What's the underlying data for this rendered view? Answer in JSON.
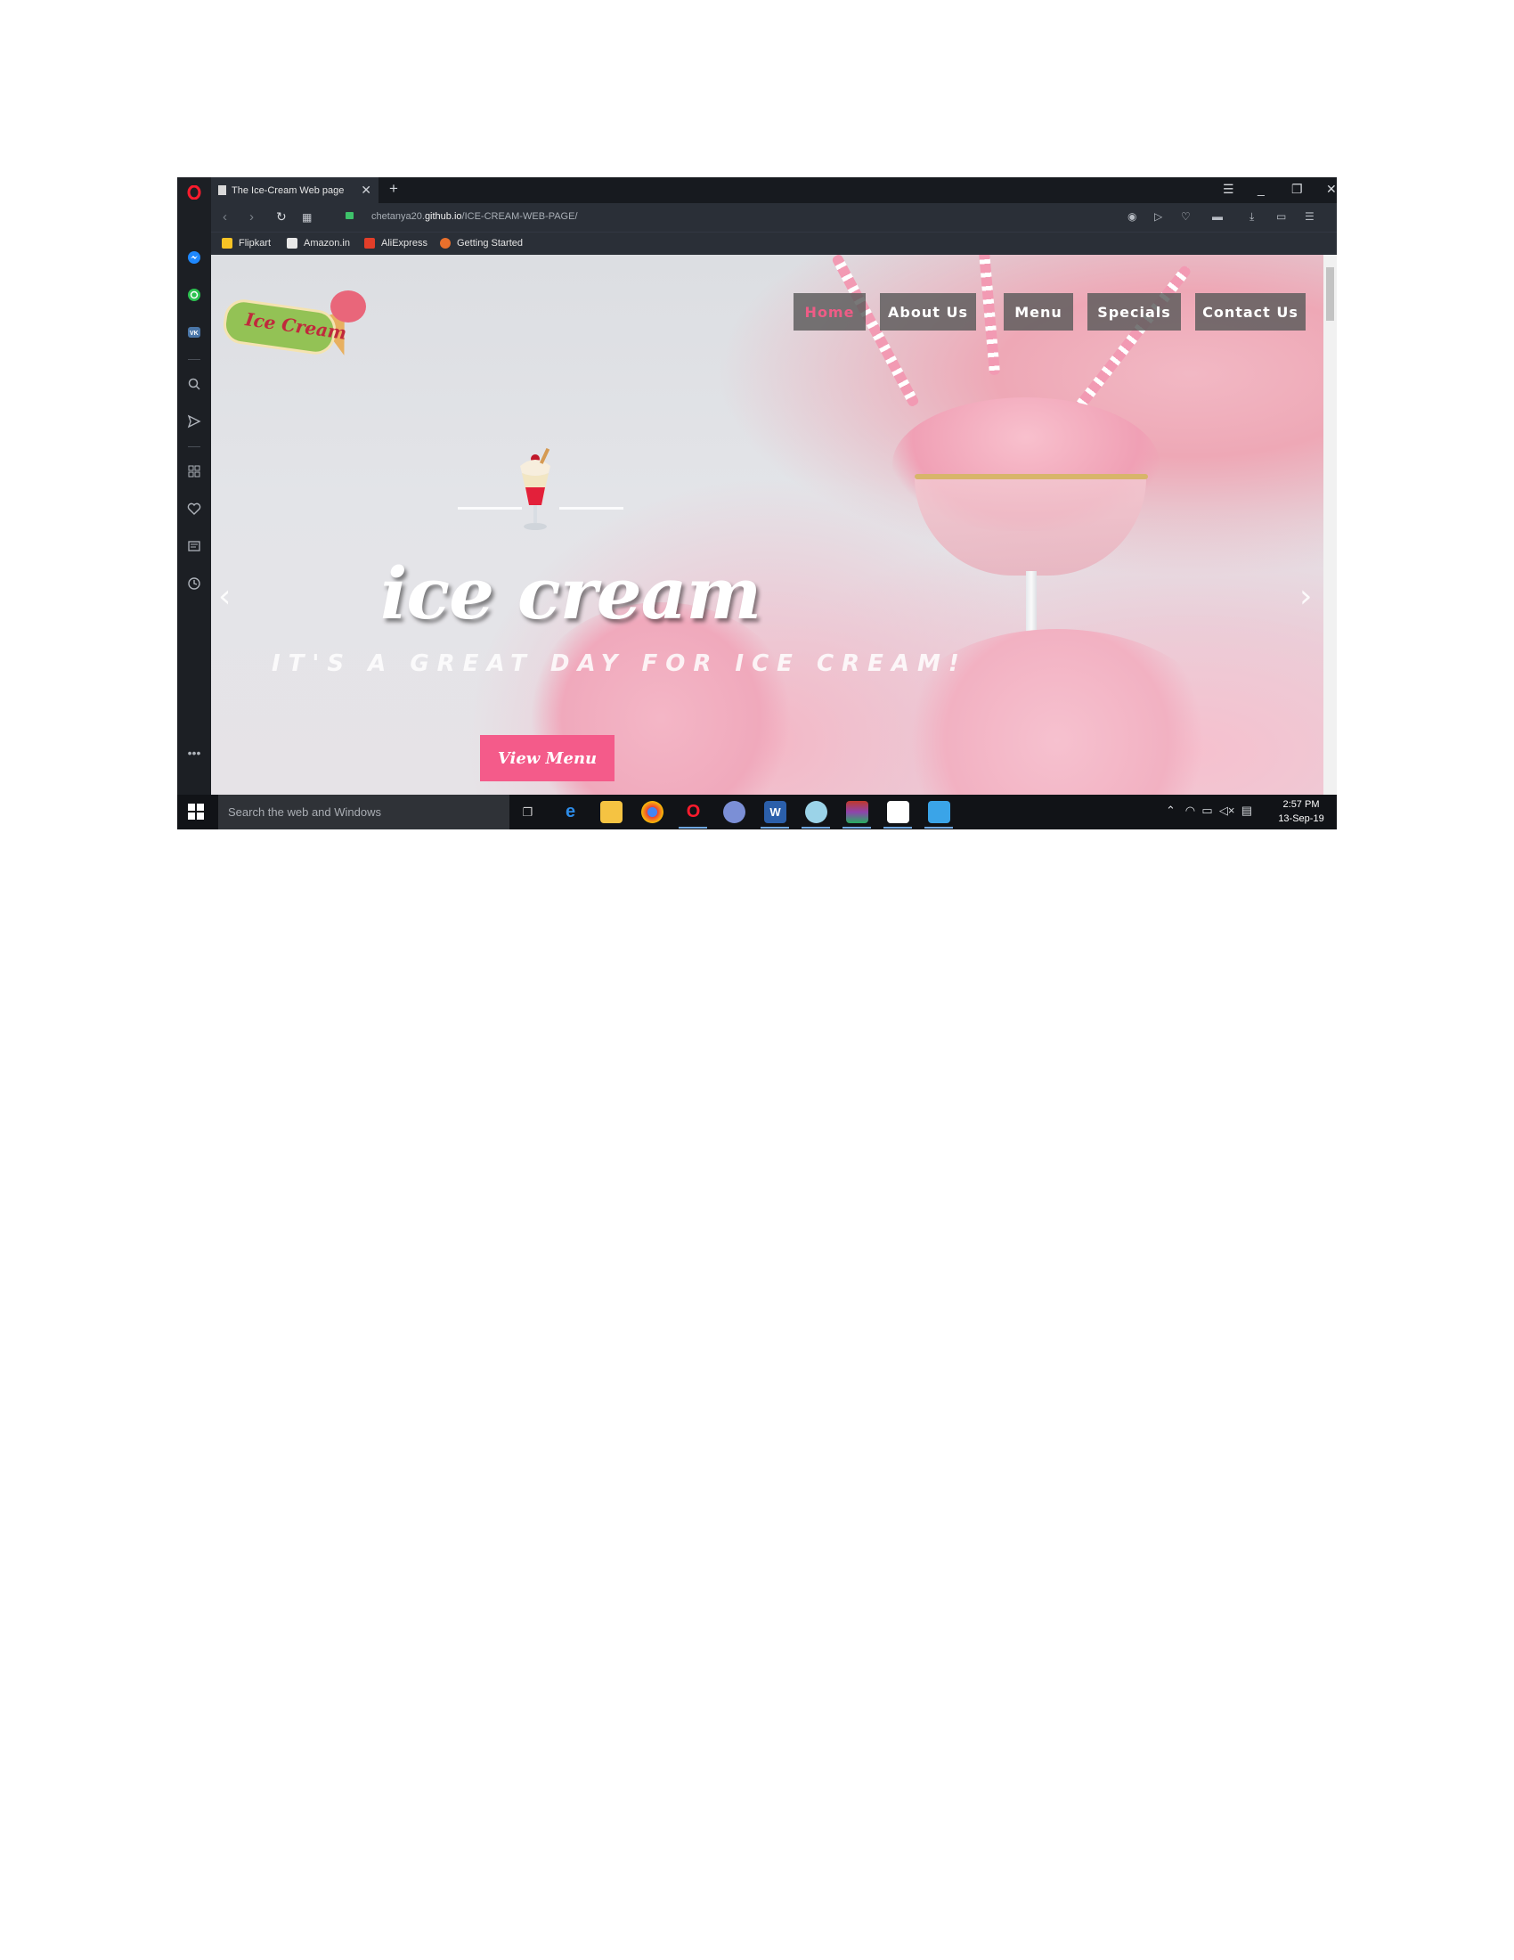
{
  "browser": {
    "tab_title": "The Ice-Cream Web page",
    "new_tab": "+",
    "url_prefix": "chetanya20.",
    "url_domain": "github.io",
    "url_path": "/ICE-CREAM-WEB-PAGE/",
    "bookmarks": [
      {
        "label": "Flipkart",
        "color": "#f7c325"
      },
      {
        "label": "Amazon.in",
        "color": "#e8e8e8"
      },
      {
        "label": "AliExpress",
        "color": "#e23e29"
      },
      {
        "label": "Getting Started",
        "color": "#e9702c"
      }
    ]
  },
  "site": {
    "logo_text": "Ice Cream",
    "nav": [
      {
        "label": "Home",
        "active": true
      },
      {
        "label": "About Us",
        "active": false
      },
      {
        "label": "Menu",
        "active": false
      },
      {
        "label": "Specials",
        "active": false
      },
      {
        "label": "Contact Us",
        "active": false
      }
    ],
    "hero_title": "ice cream",
    "hero_subtitle": "IT'S A GREAT DAY FOR ICE CREAM!",
    "cta_label": "View Menu",
    "accent_color": "#f45b8a"
  },
  "taskbar": {
    "search_placeholder": "Search the web and Windows",
    "time": "2:57 PM",
    "date": "13-Sep-19"
  }
}
